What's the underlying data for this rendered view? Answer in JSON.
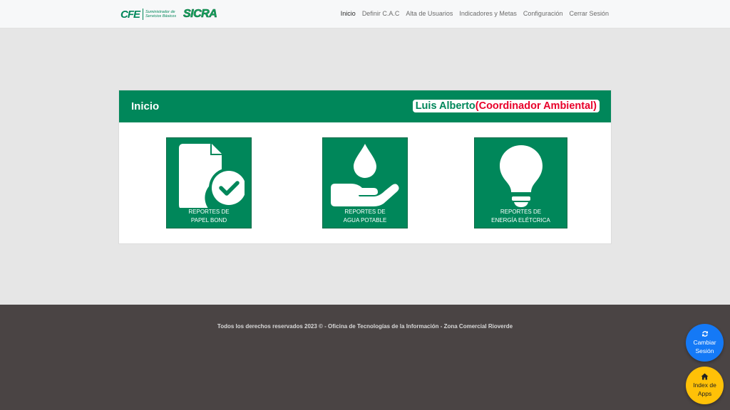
{
  "brand": {
    "cfe": "CFE",
    "subtitle_line1": "Suministrador de",
    "subtitle_line2": "Servicios Básicos",
    "sicra": "SICRA"
  },
  "nav": {
    "items": [
      {
        "label": "Inicio",
        "active": true
      },
      {
        "label": "Definir C.A.C",
        "active": false
      },
      {
        "label": "Alta de Usuarios",
        "active": false
      },
      {
        "label": "Indicadores y Metas",
        "active": false
      },
      {
        "label": "Configuración",
        "active": false
      },
      {
        "label": "Cerrar Sesión",
        "active": false
      }
    ]
  },
  "card": {
    "title": "Inicio",
    "user_name": "Luis Alberto",
    "user_role": "(Coordinador Ambiental)"
  },
  "tiles": [
    {
      "icon": "document-check-icon",
      "line1": "REPORTES DE",
      "line2": "PAPEL BOND"
    },
    {
      "icon": "water-drop-hand-icon",
      "line1": "REPORTES DE",
      "line2": "AGUA POTABLE"
    },
    {
      "icon": "lightbulb-icon",
      "line1": "REPORTES DE",
      "line2": "ENERGÍA ELÉTCRICA"
    }
  ],
  "footer": {
    "text": "Todos los derechos reservados 2023 © - Oficina de Tecnologías de la Información - Zona Comercial Rioverde"
  },
  "fabs": {
    "change_session": {
      "icon": "refresh-icon",
      "line1": "Cambiar",
      "line2": "Sesión"
    },
    "apps_index": {
      "icon": "home-icon",
      "line1": "Index de",
      "line2": "Apps"
    }
  },
  "colors": {
    "brand_green": "#00875a",
    "role_red": "#e8002a",
    "footer_bg": "#4a4444",
    "fab_blue": "#1479f6",
    "fab_yellow": "#ffc107"
  }
}
